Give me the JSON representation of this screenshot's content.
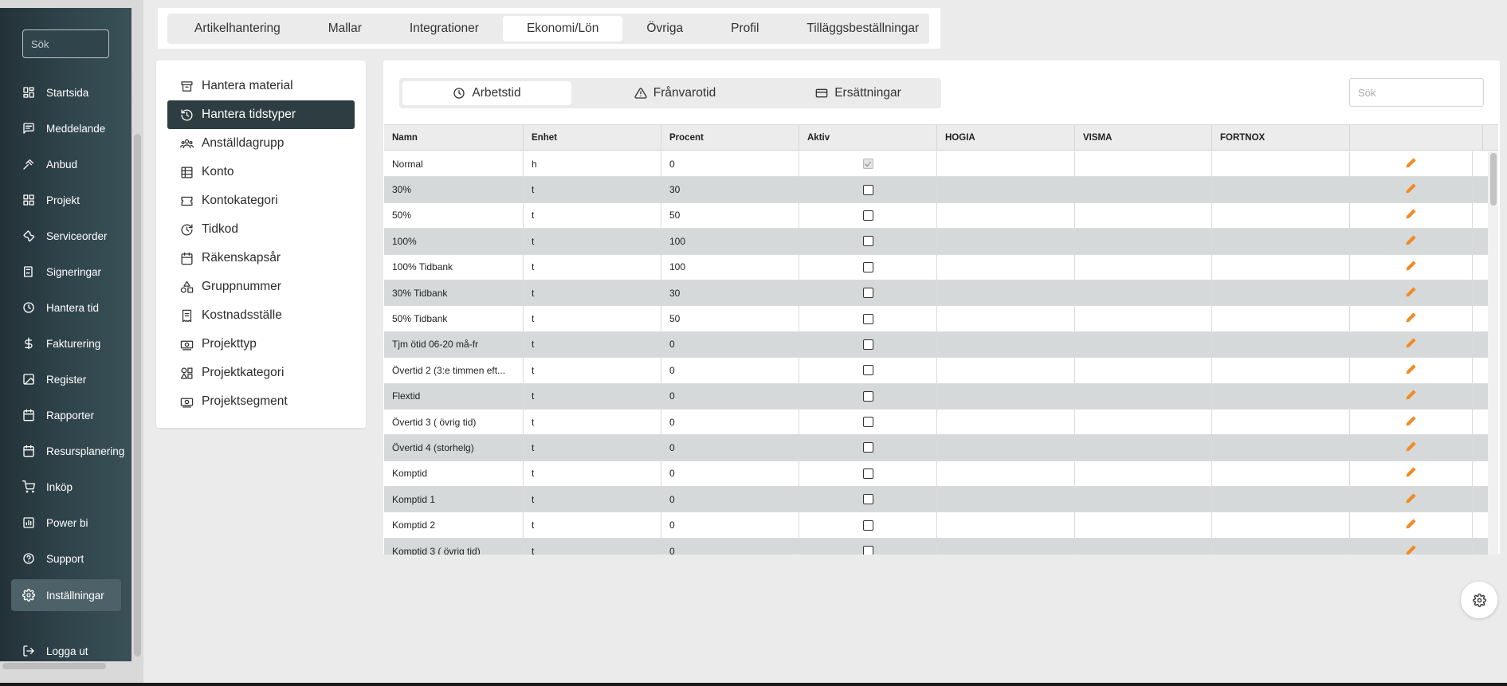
{
  "sidebar": {
    "search_placeholder": "Sök",
    "items": [
      {
        "label": "Startsida",
        "icon": "dashboard-icon"
      },
      {
        "label": "Meddelande",
        "icon": "message-icon"
      },
      {
        "label": "Anbud",
        "icon": "gavel-icon"
      },
      {
        "label": "Projekt",
        "icon": "grid-icon"
      },
      {
        "label": "Serviceorder",
        "icon": "wrench-icon"
      },
      {
        "label": "Signeringar",
        "icon": "sign-icon"
      },
      {
        "label": "Hantera tid",
        "icon": "clock-icon"
      },
      {
        "label": "Fakturering",
        "icon": "dollar-icon"
      },
      {
        "label": "Register",
        "icon": "image-icon"
      },
      {
        "label": "Rapporter",
        "icon": "calendar-icon"
      },
      {
        "label": "Resursplanering",
        "icon": "calendar-icon"
      },
      {
        "label": "Inköp",
        "icon": "cart-icon"
      },
      {
        "label": "Power bi",
        "icon": "bar-chart-icon"
      },
      {
        "label": "Support",
        "icon": "help-icon"
      },
      {
        "label": "Inställningar",
        "icon": "gear-icon",
        "active": true
      }
    ],
    "logout_label": "Logga ut"
  },
  "top_tabs": [
    {
      "label": "Artikelhantering"
    },
    {
      "label": "Mallar"
    },
    {
      "label": "Integrationer"
    },
    {
      "label": "Ekonomi/Lön",
      "active": true
    },
    {
      "label": "Övriga"
    },
    {
      "label": "Profil"
    },
    {
      "label": "Tilläggsbeställningar"
    }
  ],
  "settings_menu": [
    {
      "label": "Hantera material",
      "icon": "archive-icon"
    },
    {
      "label": "Hantera tidstyper",
      "icon": "clock-history-icon",
      "active": true
    },
    {
      "label": "Anställdagrupp",
      "icon": "group-icon"
    },
    {
      "label": "Konto",
      "icon": "ledger-icon"
    },
    {
      "label": "Kontokategori",
      "icon": "ticket-icon"
    },
    {
      "label": "Tidkod",
      "icon": "clock-refresh-icon"
    },
    {
      "label": "Räkenskapsår",
      "icon": "calendar-icon"
    },
    {
      "label": "Gruppnummer",
      "icon": "shapes-icon"
    },
    {
      "label": "Kostnadsställe",
      "icon": "receipt-icon"
    },
    {
      "label": "Projekttyp",
      "icon": "cash-icon"
    },
    {
      "label": "Projektkategori",
      "icon": "category-icon"
    },
    {
      "label": "Projektsegment",
      "icon": "cash-icon"
    }
  ],
  "sub_tabs": [
    {
      "label": "Arbetstid",
      "icon": "clock-icon",
      "active": true
    },
    {
      "label": "Frånvarotid",
      "icon": "warning-icon"
    },
    {
      "label": "Ersättningar",
      "icon": "card-icon"
    }
  ],
  "table_search_placeholder": "Sök",
  "table": {
    "columns": [
      "Namn",
      "Enhet",
      "Procent",
      "Aktiv",
      "HOGIA",
      "VISMA",
      "FORTNOX",
      ""
    ],
    "rows": [
      {
        "namn": "Normal",
        "enhet": "h",
        "procent": "0",
        "aktiv": true,
        "hogia": "",
        "visma": "",
        "fortnox": ""
      },
      {
        "namn": "30%",
        "enhet": "t",
        "procent": "30",
        "aktiv": false,
        "hogia": "",
        "visma": "",
        "fortnox": ""
      },
      {
        "namn": "50%",
        "enhet": "t",
        "procent": "50",
        "aktiv": false,
        "hogia": "",
        "visma": "",
        "fortnox": ""
      },
      {
        "namn": "100%",
        "enhet": "t",
        "procent": "100",
        "aktiv": false,
        "hogia": "",
        "visma": "",
        "fortnox": ""
      },
      {
        "namn": "100% Tidbank",
        "enhet": "t",
        "procent": "100",
        "aktiv": false,
        "hogia": "",
        "visma": "",
        "fortnox": ""
      },
      {
        "namn": "30% Tidbank",
        "enhet": "t",
        "procent": "30",
        "aktiv": false,
        "hogia": "",
        "visma": "",
        "fortnox": ""
      },
      {
        "namn": "50% Tidbank",
        "enhet": "t",
        "procent": "50",
        "aktiv": false,
        "hogia": "",
        "visma": "",
        "fortnox": ""
      },
      {
        "namn": "Tjm ötid 06-20 må-fr",
        "enhet": "t",
        "procent": "0",
        "aktiv": false,
        "hogia": "",
        "visma": "",
        "fortnox": ""
      },
      {
        "namn": "Övertid 2 (3:e timmen eft...",
        "enhet": "t",
        "procent": "0",
        "aktiv": false,
        "hogia": "",
        "visma": "",
        "fortnox": ""
      },
      {
        "namn": "Flextid",
        "enhet": "t",
        "procent": "0",
        "aktiv": false,
        "hogia": "",
        "visma": "",
        "fortnox": ""
      },
      {
        "namn": "Övertid 3 ( övrig tid)",
        "enhet": "t",
        "procent": "0",
        "aktiv": false,
        "hogia": "",
        "visma": "",
        "fortnox": ""
      },
      {
        "namn": "Övertid 4 (storhelg)",
        "enhet": "t",
        "procent": "0",
        "aktiv": false,
        "hogia": "",
        "visma": "",
        "fortnox": ""
      },
      {
        "namn": "Komptid",
        "enhet": "t",
        "procent": "0",
        "aktiv": false,
        "hogia": "",
        "visma": "",
        "fortnox": ""
      },
      {
        "namn": "Komptid 1",
        "enhet": "t",
        "procent": "0",
        "aktiv": false,
        "hogia": "",
        "visma": "",
        "fortnox": ""
      },
      {
        "namn": "Komptid 2",
        "enhet": "t",
        "procent": "0",
        "aktiv": false,
        "hogia": "",
        "visma": "",
        "fortnox": ""
      },
      {
        "namn": "Komptid 3 ( övrig tid)",
        "enhet": "t",
        "procent": "0",
        "aktiv": false,
        "hogia": "",
        "visma": "",
        "fortnox": ""
      }
    ]
  },
  "colors": {
    "sidebar_bg": "#2e4249",
    "active_menu": "#2d3d42",
    "edit_icon": "#f08a24",
    "row_alt": "#d5d9d9"
  }
}
